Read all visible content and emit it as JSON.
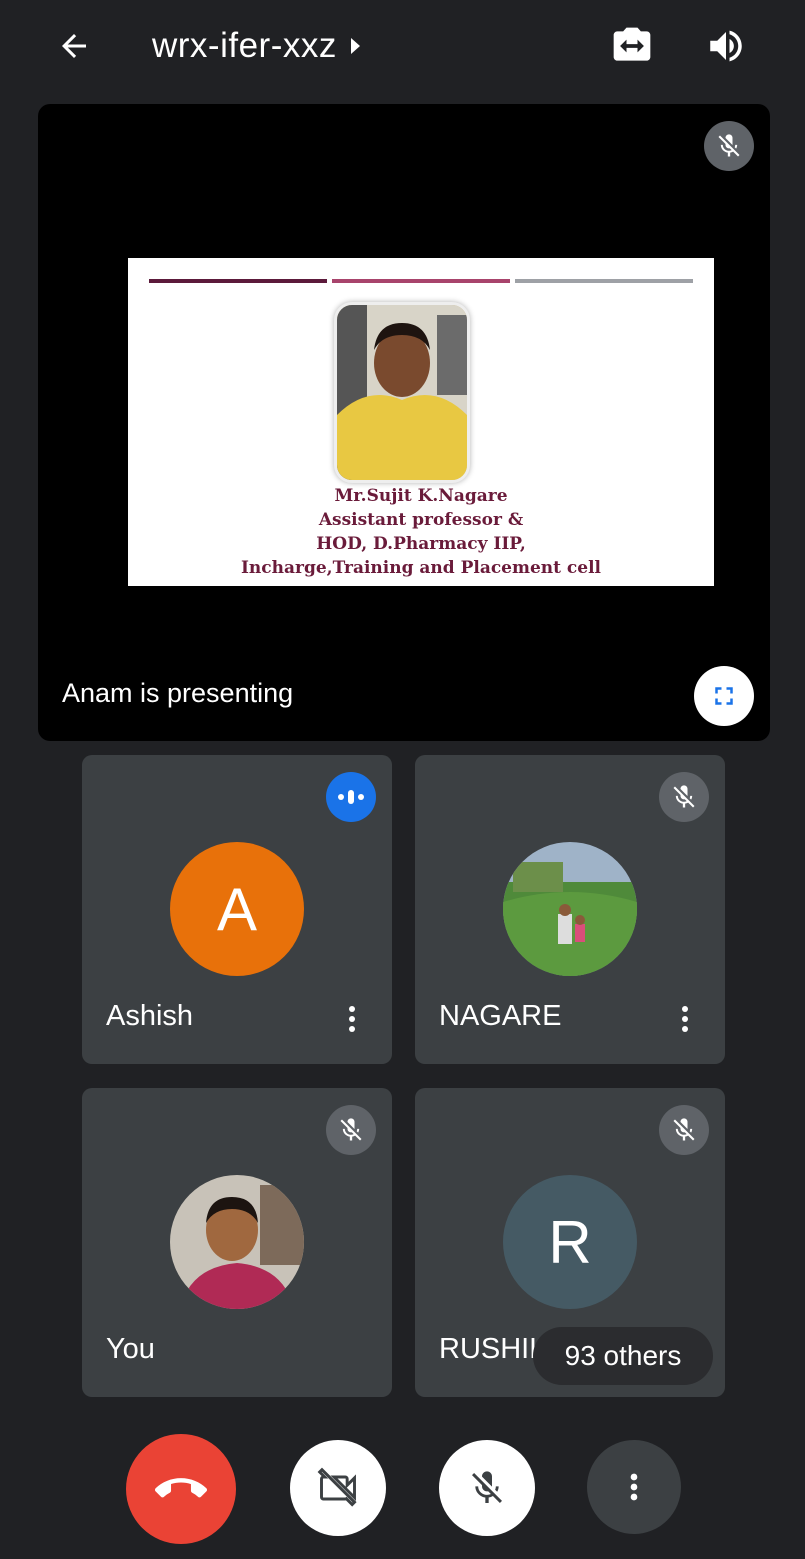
{
  "header": {
    "meeting_code": "wrx-ifer-xxz",
    "back_icon": "arrow-left-icon",
    "switch_camera_icon": "switch-camera-icon",
    "speaker_icon": "speaker-icon"
  },
  "presentation": {
    "presenting_label": "Anam is presenting",
    "slide": {
      "lines": [
        "Mr.Sujit K.Nagare",
        "Assistant professor &",
        "HOD, D.Pharmacy IIP,",
        "Incharge,Training and Placement cell"
      ],
      "bar_colors": [
        "#5c1a3b",
        "#a8446c",
        "#9ea1a6"
      ]
    },
    "muted": true
  },
  "participants": [
    {
      "name": "Ashish",
      "initial": "A",
      "avatar_color": "#e8710a",
      "speaking": true
    },
    {
      "name": "NAGARE",
      "avatar": "photo",
      "muted": true
    },
    {
      "name": "You",
      "avatar": "photo",
      "muted": true
    },
    {
      "name": "RUSHIKESH",
      "initial": "R",
      "avatar_color": "#455a64",
      "muted": true
    }
  ],
  "others_label": "93 others",
  "controls": {
    "end_call_color": "#ea4335",
    "end_call_icon": "call-end-icon",
    "camera_icon": "videocam-off-icon",
    "mic_icon": "mic-off-icon",
    "more_icon": "more-vert-icon"
  }
}
